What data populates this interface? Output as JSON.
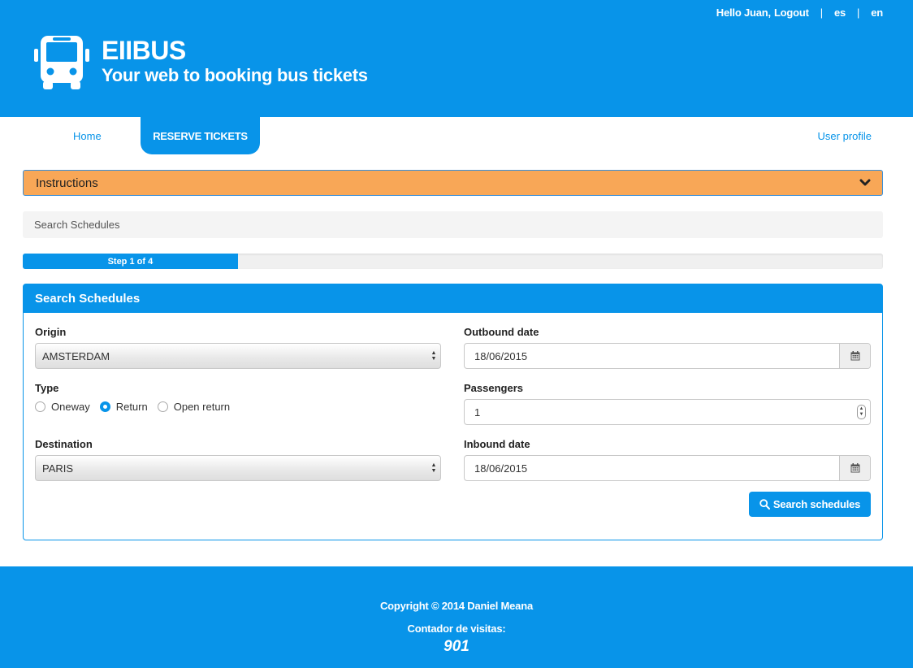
{
  "header": {
    "greeting": "Hello Juan,",
    "logout_label": "Logout",
    "lang_es": "es",
    "lang_en": "en",
    "separator": "|",
    "brand_title": "EIIBUS",
    "brand_subtitle": "Your web to booking bus tickets",
    "logo_icon": "bus-icon",
    "color": "#0894e9"
  },
  "nav": {
    "home": "Home",
    "reserve": "RESERVE TICKETS",
    "profile": "User profile"
  },
  "instructions": {
    "label": "Instructions",
    "icon": "chevron-down-icon",
    "color": "#f8a757"
  },
  "breadcrumb": {
    "current": "Search Schedules"
  },
  "progress": {
    "label": "Step 1 of 4",
    "step": 1,
    "total": 4,
    "fraction": 0.25
  },
  "panel": {
    "title": "Search Schedules",
    "origin_label": "Origin",
    "origin_value": "AMSTERDAM",
    "type_label": "Type",
    "type_options": [
      "Oneway",
      "Return",
      "Open return"
    ],
    "type_selected": "Return",
    "destination_label": "Destination",
    "destination_value": "PARIS",
    "outbound_label": "Outbound date",
    "outbound_value": "18/06/2015",
    "passengers_label": "Passengers",
    "passengers_value": "1",
    "inbound_label": "Inbound date",
    "inbound_value": "18/06/2015",
    "calendar_icon": "calendar-icon",
    "search_button": "Search schedules",
    "search_icon": "search-icon"
  },
  "footer": {
    "copyright": "Copyright © 2014 Daniel Meana",
    "visits_label": "Contador de visitas:",
    "visits_count": "901"
  }
}
